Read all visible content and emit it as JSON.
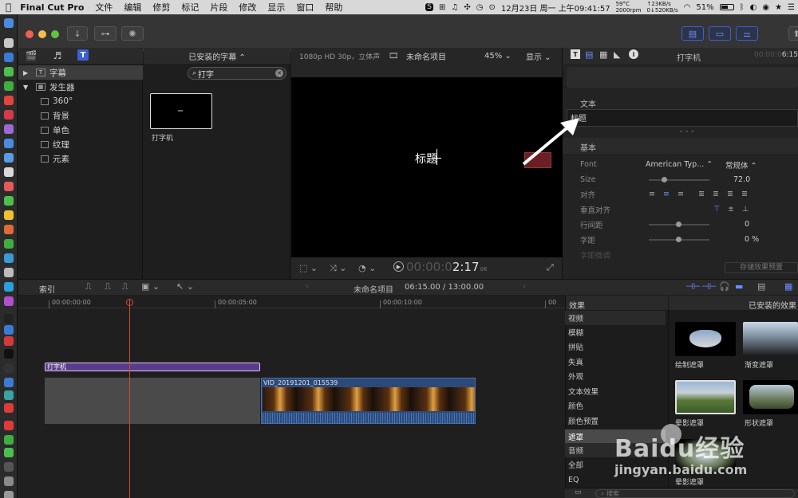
{
  "menubar": {
    "app": "Final Cut Pro",
    "items": [
      "文件",
      "编辑",
      "修剪",
      "标记",
      "片段",
      "修改",
      "显示",
      "窗口",
      "帮助"
    ],
    "temp": "59°C",
    "fan": "2000rpm",
    "net_up": "↑23KB/s",
    "net_down": "0↓520KB/s",
    "datetime": "12月23日 周一 上午09:41:57",
    "battery": "51%"
  },
  "browser": {
    "sidebar_title_selected": "字幕",
    "sidebar_generators": "发生器",
    "generator_items": [
      "360°",
      "背景",
      "单色",
      "纹理",
      "元素"
    ],
    "installed_titles": "已安装的字幕",
    "search_value": "打字",
    "clip_label": "打字机"
  },
  "viewer": {
    "format": "1080p HD 30p，立体声",
    "project": "未命名项目",
    "zoom": "45%",
    "display": "显示",
    "title_text": "标题",
    "timecode": "00:00:02:17",
    "timecode_dim": "00:00:0",
    "timecode_bright": "2:17",
    "timecode_sub": "06"
  },
  "inspector": {
    "title": "打字机",
    "timecode_dim": "00:00:0",
    "timecode_bright": "6:15",
    "section_text": "文本",
    "text_value": "标题",
    "section_basic": "基本",
    "rows": {
      "font_label": "Font",
      "font_value": "American Typ...",
      "font_style": "常规体",
      "size_label": "Size",
      "size_value": "72.0",
      "align_label": "对齐",
      "valign_label": "垂直对齐",
      "line_spacing_label": "行间距",
      "line_spacing_value": "0",
      "tracking_label": "字距",
      "tracking_value": "0 %",
      "kerning_label": "字距微调"
    },
    "save_preset": "存储效果预置"
  },
  "timeline": {
    "index": "索引",
    "project": "未命名项目",
    "duration": "06:15.00 / 13:00.00",
    "ruler": [
      "00:00:00:00",
      "00:00:05:00",
      "00:00:10:00",
      "00"
    ],
    "title_clip": "打字机",
    "video_clip": "VID_20191201_015539"
  },
  "effects": {
    "header": "效果",
    "installed": "已安装的效果",
    "categories": [
      "视频",
      "模糊",
      "拼贴",
      "失真",
      "外观",
      "文本效果",
      "颜色",
      "颜色预置",
      "遮罩",
      "音频",
      "全部",
      "EQ"
    ],
    "selected_category": "遮罩",
    "thumbs": [
      "绘制遮罩",
      "渐变遮罩",
      "晕影遮罩",
      "形状遮罩",
      "晕影遮罩"
    ],
    "search_placeholder": "搜索"
  },
  "watermark": {
    "text": "Baidu经验",
    "url": "jingyan.baidu.com"
  },
  "colors": {
    "accent": "#6a8cff",
    "title_clip": "#5a3b8c",
    "video_clip": "#2b4a7a",
    "playhead": "#d24a2a"
  }
}
